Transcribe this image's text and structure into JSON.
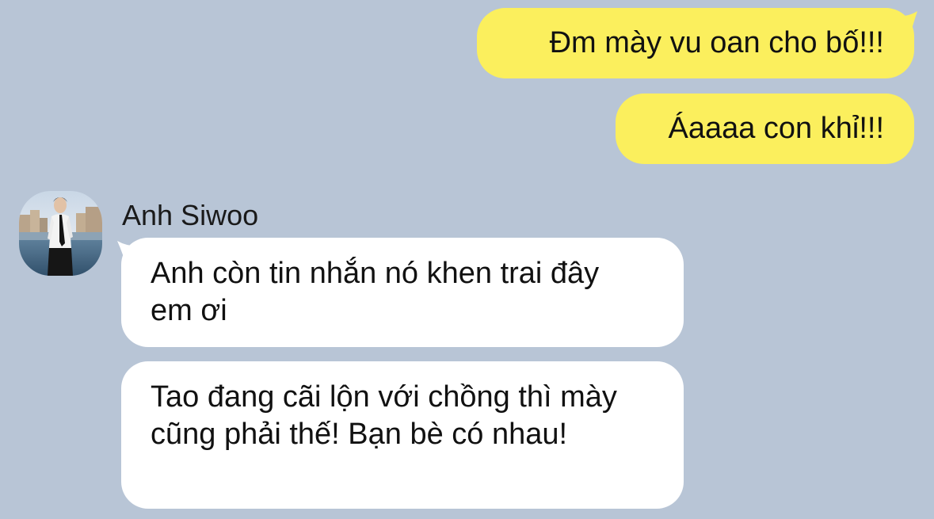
{
  "conversation": {
    "outgoing": [
      {
        "text": "Đm mày vu oan cho bố!!!"
      },
      {
        "text": "Áaaaa con khỉ!!!"
      }
    ],
    "incoming": {
      "sender_name": "Anh Siwoo",
      "avatar_icon": "person-photo-avatar",
      "messages": [
        {
          "text": "Anh còn tin nhắn nó khen trai đây em ơi"
        },
        {
          "text": "Tao đang cãi lộn với chồng thì mày cũng phải thế! Bạn bè có nhau!"
        }
      ]
    }
  },
  "colors": {
    "background": "#b8c5d6",
    "outgoing_bubble": "#fbef5d",
    "incoming_bubble": "#ffffff",
    "text": "#111111"
  }
}
